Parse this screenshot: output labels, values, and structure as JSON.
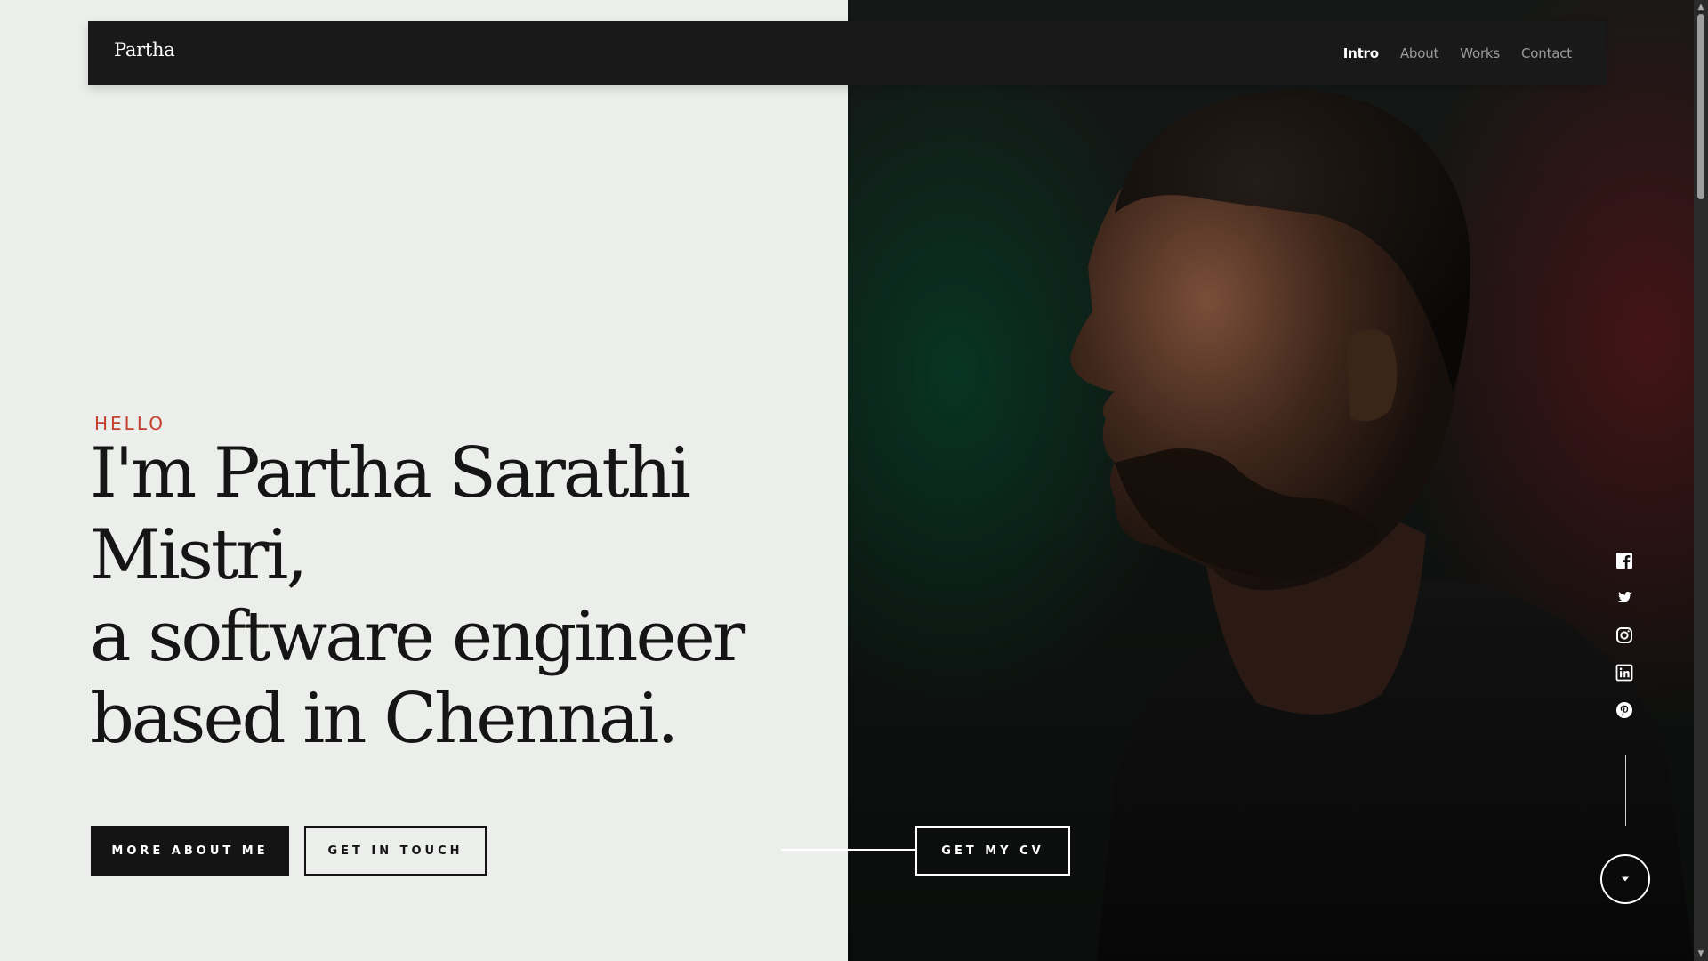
{
  "header": {
    "brand": "Partha",
    "nav": [
      {
        "label": "Intro",
        "active": true
      },
      {
        "label": "About",
        "active": false
      },
      {
        "label": "Works",
        "active": false
      },
      {
        "label": "Contact",
        "active": false
      }
    ]
  },
  "hero": {
    "greeting": "HELLO",
    "headline_lines": [
      "I'm Partha Sarathi",
      "Mistri,",
      "a software engineer",
      "based in Chennai."
    ]
  },
  "buttons": {
    "more_about": "MORE ABOUT ME",
    "get_in_touch": "GET IN TOUCH",
    "get_cv": "GET MY CV"
  },
  "social": [
    {
      "icon": "facebook-icon"
    },
    {
      "icon": "twitter-icon"
    },
    {
      "icon": "instagram-icon"
    },
    {
      "icon": "linkedin-icon"
    },
    {
      "icon": "pinterest-icon"
    }
  ],
  "colors": {
    "accent": "#c4402c",
    "dark": "#191919",
    "light_bg": "#eceeeb"
  }
}
